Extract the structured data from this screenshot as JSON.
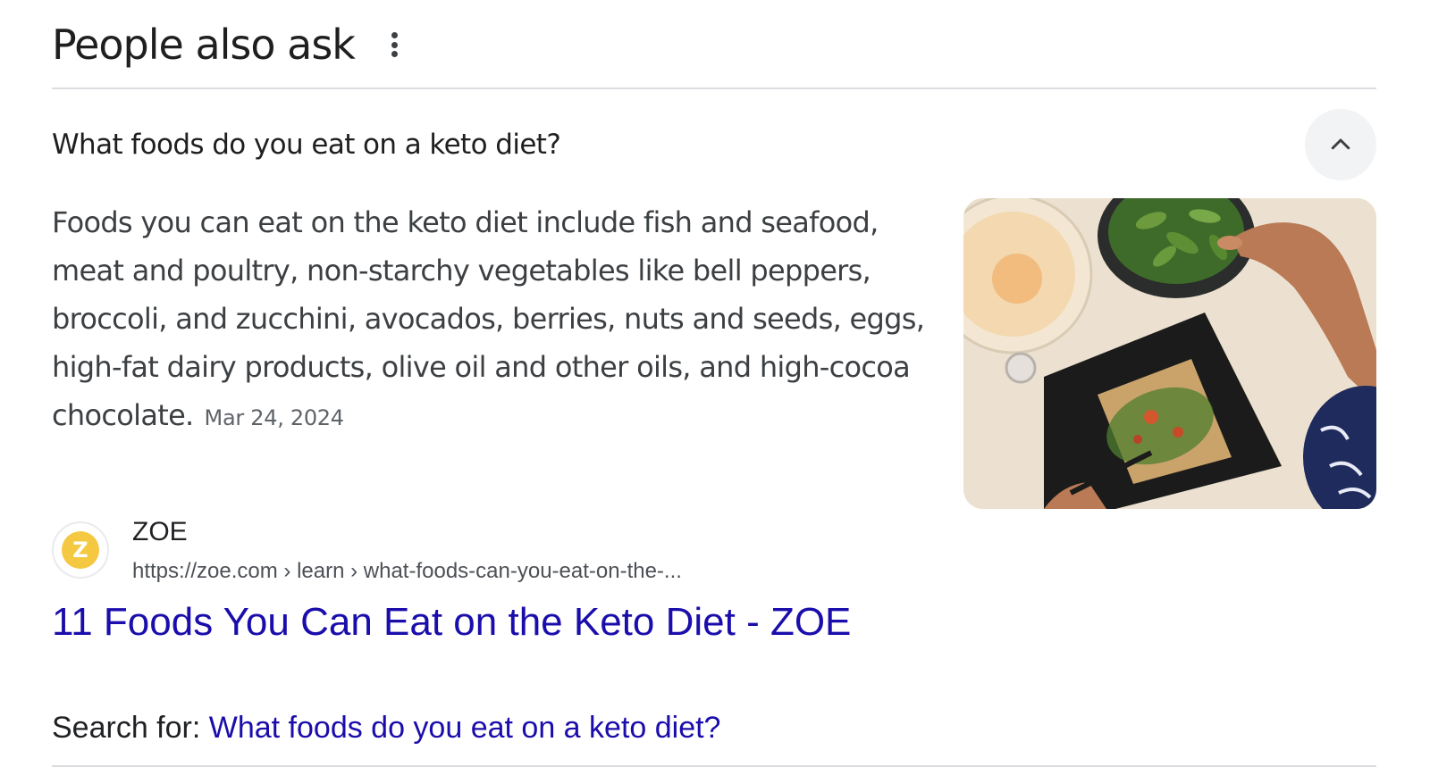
{
  "header": {
    "title": "People also ask",
    "more_icon": "more-vert-icon"
  },
  "question": {
    "text": "What foods do you eat on a keto diet?",
    "expanded": true,
    "toggle_icon": "chevron-up-icon"
  },
  "answer": {
    "text": "Foods you can eat on the keto diet include fish and seafood, meat and poultry, non-starchy vegetables like bell peppers, broccoli, and zucchini, avocados, berries, nuts and seeds, eggs, high-fat dairy products, olive oil and other oils, and high-cocoa chocolate.",
    "date": "Mar 24, 2024"
  },
  "source": {
    "name": "ZOE",
    "url": "https://zoe.com › learn › what-foods-can-you-eat-on-the-...",
    "favicon_icon": "zoe-logo-icon"
  },
  "result": {
    "title": "11 Foods You Can Eat on the Keto Diet - ZOE"
  },
  "search_for": {
    "label": "Search for: ",
    "query": "What foods do you eat on a keto diet?"
  },
  "colors": {
    "link": "#1a0dab",
    "divider": "#dadce0",
    "button_bg": "#f1f3f4",
    "favicon_accent": "#f5c842"
  }
}
